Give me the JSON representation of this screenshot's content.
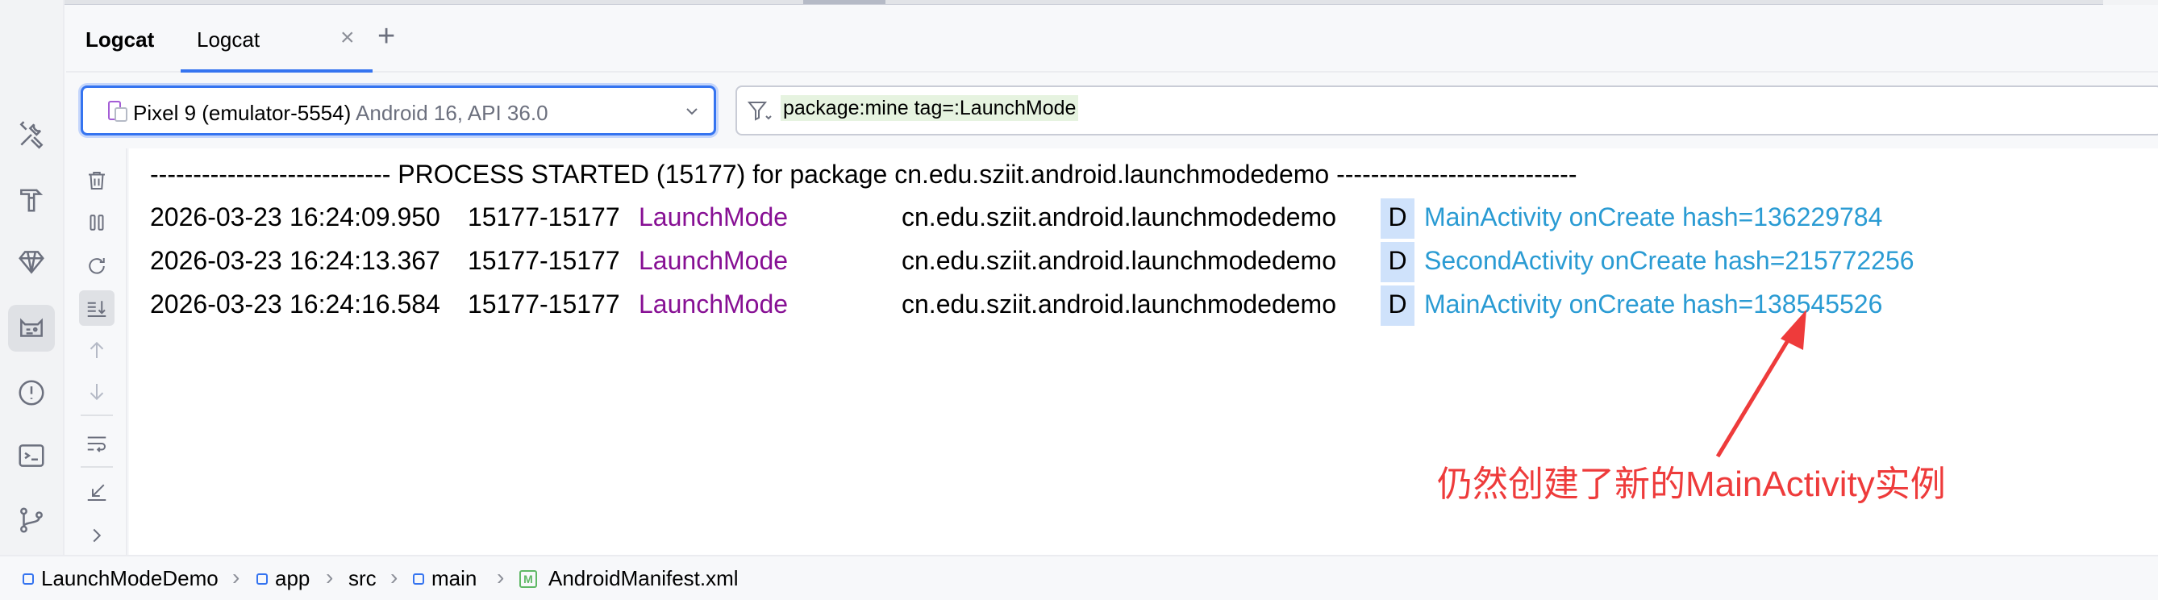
{
  "toolWindow": {
    "title": "Logcat",
    "tabs": [
      {
        "label": "Logcat",
        "close": "×"
      }
    ],
    "addTab": "+"
  },
  "device": {
    "name": "Pixel 9 (emulator-5554)",
    "api": "Android 16, API 36.0"
  },
  "filter": {
    "query": "package:mine tag=:LaunchMode"
  },
  "log": {
    "processStarted": "---------------------------- PROCESS STARTED (15177) for package cn.edu.sziit.android.launchmodedemo ----------------------------",
    "entries": [
      {
        "date": "2026-03-23",
        "time": "16:24:09.950",
        "pid": "15177-15177",
        "tag": "LaunchMode",
        "package": "cn.edu.sziit.android.launchmodedemo",
        "level": "D",
        "message": "MainActivity  onCreate  hash=136229784"
      },
      {
        "date": "2026-03-23",
        "time": "16:24:13.367",
        "pid": "15177-15177",
        "tag": "LaunchMode",
        "package": "cn.edu.sziit.android.launchmodedemo",
        "level": "D",
        "message": "SecondActivity onCreate  hash=215772256"
      },
      {
        "date": "2026-03-23",
        "time": "16:24:16.584",
        "pid": "15177-15177",
        "tag": "LaunchMode",
        "package": "cn.edu.sziit.android.launchmodedemo",
        "level": "D",
        "message": "MainActivity  onCreate  hash=138545526"
      }
    ]
  },
  "annotation": {
    "text": "仍然创建了新的MainActivity实例",
    "color": "#ee3b3b"
  },
  "breadcrumb": [
    "LaunchModeDemo",
    "app",
    "src",
    "main",
    "AndroidManifest.xml"
  ],
  "colors": {
    "accent": "#3574f0",
    "tag": "#871094",
    "message": "#2a9bd3",
    "levelHighlight": "#cfe2fb"
  }
}
